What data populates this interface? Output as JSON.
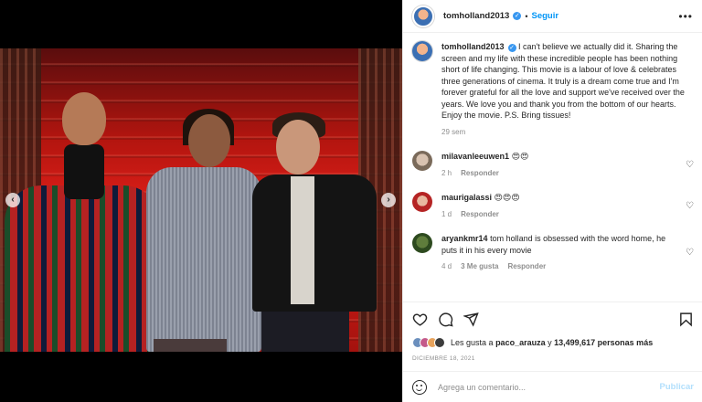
{
  "header": {
    "username": "tomholland2013",
    "separator": "•",
    "follow_label": "Seguir",
    "more_label": "•••"
  },
  "media": {
    "prev_label": "‹",
    "next_label": "›",
    "slide_dots": 4,
    "active_slide": 2
  },
  "caption": {
    "username": "tomholland2013",
    "text": "I can't believe we actually did it. Sharing the screen and my life with these incredible people has been nothing short of life changing. This movie is a labour of love & celebrates three generations of cinema. It truly is a dream come true and I'm forever grateful for all the love and support we've received over the years. We love you and thank you from the bottom of our hearts. Enjoy the movie. P.S. Bring tissues!",
    "time": "29 sem"
  },
  "comments": [
    {
      "username": "milavanleeuwen1",
      "text": "😍😍",
      "time": "2 h",
      "likes": "",
      "reply_label": "Responder"
    },
    {
      "username": "maurigalassi",
      "text": "😍😍😍",
      "time": "1 d",
      "likes": "",
      "reply_label": "Responder"
    },
    {
      "username": "aryankmr14",
      "text": "tom holland is obsessed with the word home, he puts it in his every movie",
      "time": "4 d",
      "likes": "3 Me gusta",
      "reply_label": "Responder"
    }
  ],
  "likes": {
    "prefix": "Les gusta a",
    "user": "paco_arauza",
    "middle": "y",
    "count": "13,499,617 personas más"
  },
  "date": "DICIEMBRE 18, 2021",
  "add_comment": {
    "placeholder": "Agrega un comentario...",
    "publish_label": "Publicar"
  },
  "colors": {
    "accent": "#0095f6",
    "verified": "#3897f0",
    "muted": "#8e8e8e",
    "publish_disabled": "#b2dffc"
  }
}
